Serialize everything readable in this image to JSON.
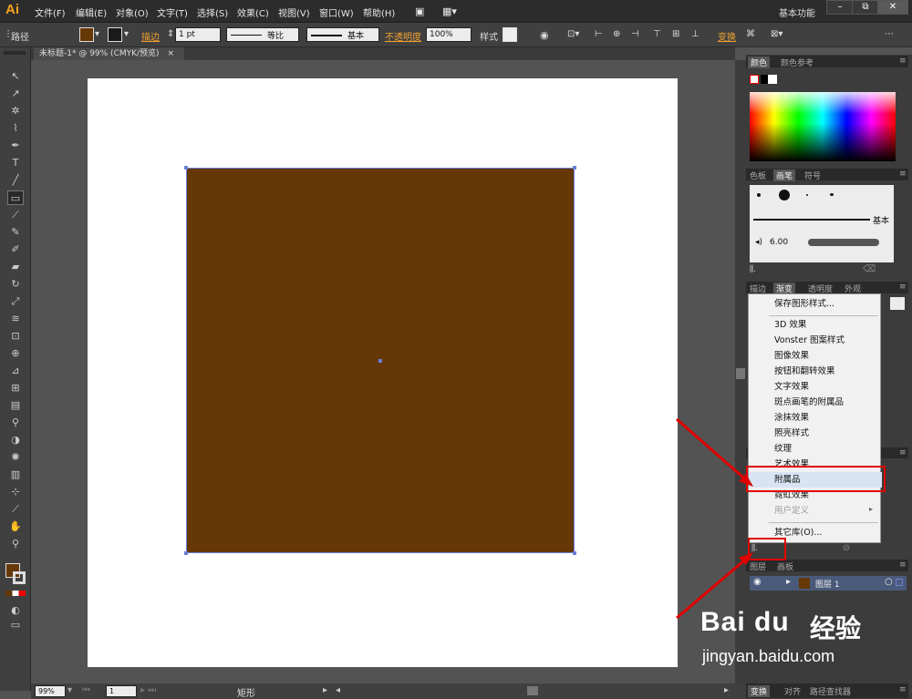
{
  "app": {
    "logo": "Ai",
    "workspace": "基本功能",
    "win_min": "–",
    "win_restore": "⧉",
    "win_close": "✕"
  },
  "menu": [
    "文件(F)",
    "编辑(E)",
    "对象(O)",
    "文字(T)",
    "选择(S)",
    "效果(C)",
    "视图(V)",
    "窗口(W)",
    "帮助(H)"
  ],
  "control": {
    "object_type": "路径",
    "stroke_label": "描边",
    "stroke_weight": "1 pt",
    "profile": "等比",
    "brush": "基本",
    "opacity_label": "不透明度",
    "opacity": "100%",
    "style_label": "样式",
    "transform_label": "变换",
    "fill_color": "#663707"
  },
  "document": {
    "tab": "未标题-1* @ 99% (CMYK/预览)",
    "close": "×",
    "fill": "#663707",
    "stroke": "#6c7fd6"
  },
  "status": {
    "zoom": "99%",
    "page": "1",
    "tool": "矩形"
  },
  "panels": {
    "color": {
      "tabs": [
        "颜色",
        "颜色参考"
      ]
    },
    "brushes": {
      "tabs": [
        "色板",
        "画笔",
        "符号"
      ],
      "basic": "基本",
      "size": "6.00"
    },
    "appearance": {
      "tabs": [
        "描边",
        "渐变",
        "透明度",
        "外观"
      ]
    },
    "layers": {
      "tabs": [
        "图层",
        "画板"
      ],
      "layer_name": "图层 1",
      "layer_color": "#663707"
    },
    "bottom": {
      "tabs": [
        "变换",
        "对齐",
        "路径查找器"
      ]
    }
  },
  "style_menu": {
    "items": [
      "保存图形样式...",
      "3D 效果",
      "Vonster 图案样式",
      "图像效果",
      "按钮和翻转效果",
      "文字效果",
      "斑点画笔的附属品",
      "涂抹效果",
      "照亮样式",
      "纹理",
      "艺术效果",
      "附属品",
      "霓虹效果",
      "用户定义",
      "其它库(O)..."
    ],
    "highlighted": "附属品",
    "disabled": "用户定义"
  },
  "watermark": {
    "brand": "Bai du",
    "brand_cn": "经验",
    "url": "jingyan.baidu.com"
  },
  "icons": [
    "arrow-icon",
    "direct-select-icon",
    "magic-wand-icon",
    "lasso-icon",
    "pen-icon",
    "type-icon",
    "line-icon",
    "rectangle-icon",
    "paintbrush-icon",
    "pencil-icon",
    "blob-brush-icon",
    "eraser-icon",
    "rotate-icon",
    "scale-icon",
    "warp-icon",
    "free-transform-icon",
    "shape-builder-icon",
    "perspective-icon",
    "mesh-icon",
    "gradient-icon",
    "eyedropper-icon",
    "blend-icon",
    "symbol-sprayer-icon",
    "graph-icon",
    "artboard-icon",
    "slice-icon",
    "hand-icon",
    "zoom-icon"
  ]
}
